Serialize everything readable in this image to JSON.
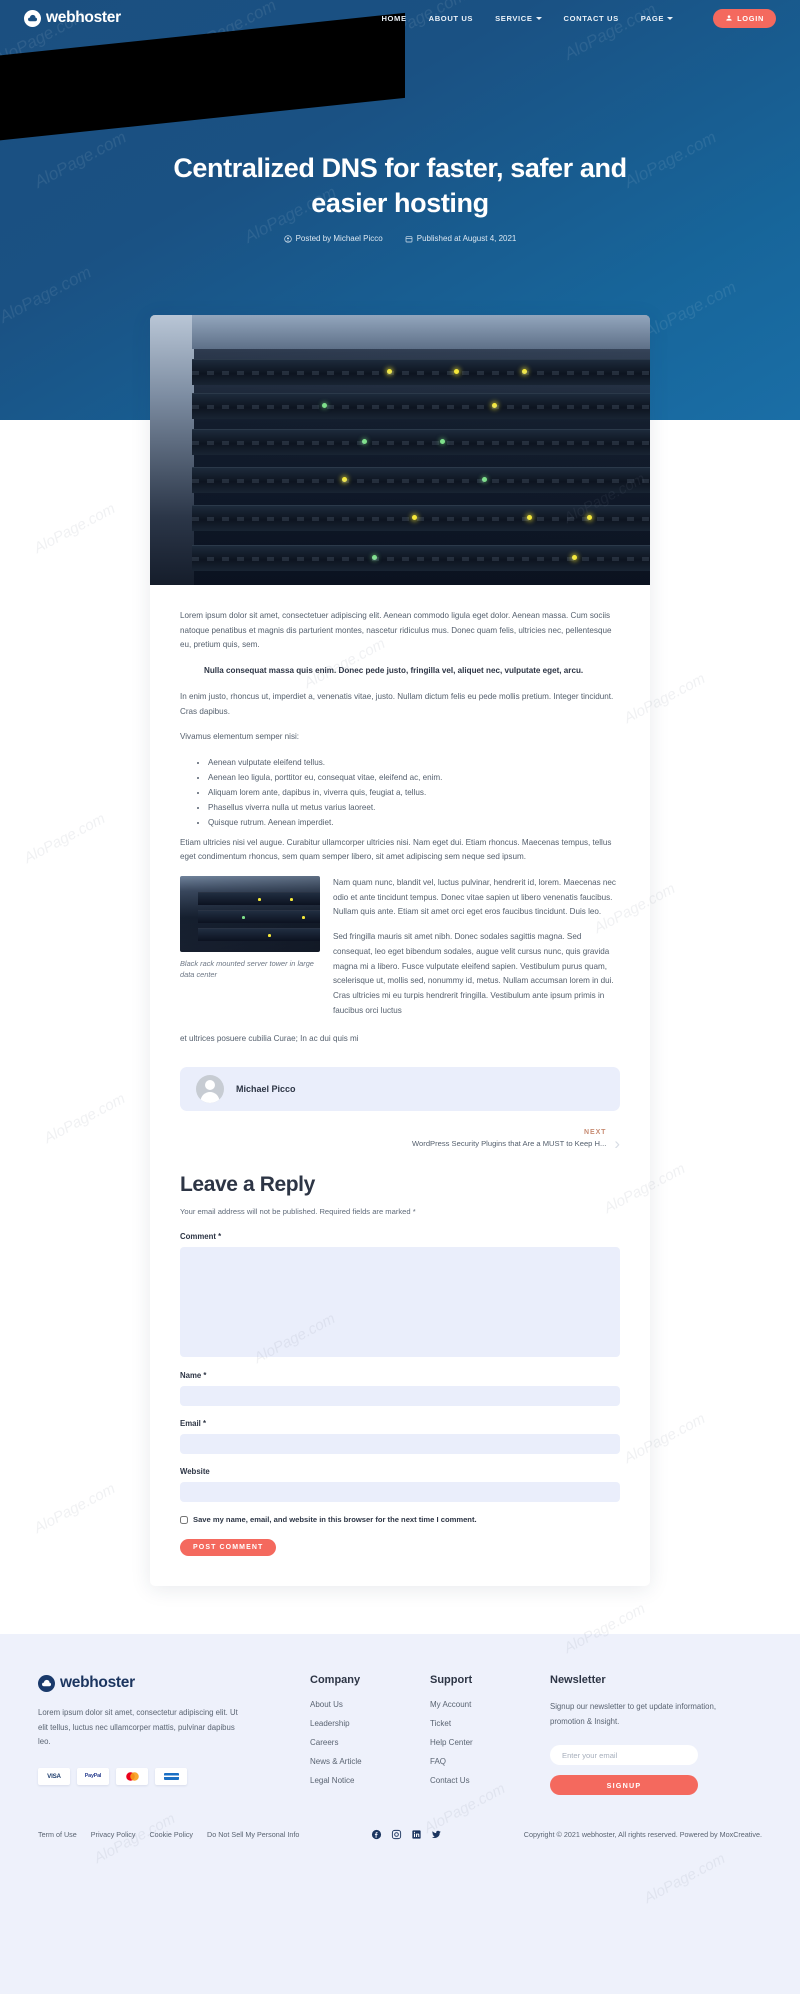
{
  "brand": {
    "name": "webhoster",
    "logo_icon": "cloud-icon"
  },
  "nav": {
    "items": [
      {
        "label": "HOME",
        "has_dropdown": false
      },
      {
        "label": "ABOUT US",
        "has_dropdown": false
      },
      {
        "label": "SERVICE",
        "has_dropdown": true
      },
      {
        "label": "CONTACT US",
        "has_dropdown": false
      },
      {
        "label": "PAGE",
        "has_dropdown": true
      }
    ],
    "login_label": "LOGIN",
    "login_icon": "user-icon",
    "login_color": "#f4695e"
  },
  "hero": {
    "title": "Centralized DNS for faster, safer and easier hosting",
    "author_meta": "Posted by Michael Picco",
    "author_icon": "user-circle-icon",
    "date_meta": "Published at August 4, 2021",
    "date_icon": "calendar-icon"
  },
  "article": {
    "featured_image_alt": "server-rack-photo",
    "paragraph_1": "Lorem ipsum dolor sit amet, consectetuer adipiscing elit. Aenean commodo ligula eget dolor. Aenean massa. Cum sociis natoque penatibus et magnis dis parturient montes, nascetur ridiculus mus. Donec quam felis, ultricies nec, pellentesque eu, pretium quis, sem.",
    "blockquote": "Nulla consequat massa quis enim. Donec pede justo, fringilla vel, aliquet nec, vulputate eget, arcu.",
    "paragraph_2": "In enim justo, rhoncus ut, imperdiet a, venenatis vitae, justo. Nullam dictum felis eu pede mollis pretium. Integer tincidunt. Cras dapibus.",
    "paragraph_3": "Vivamus elementum semper nisi:",
    "list_items": [
      "Aenean vulputate eleifend tellus.",
      "Aenean leo ligula, porttitor eu, consequat vitae, eleifend ac, enim.",
      "Aliquam lorem ante, dapibus in, viverra quis, feugiat a, tellus.",
      "Phasellus viverra nulla ut metus varius laoreet.",
      "Quisque rutrum. Aenean imperdiet."
    ],
    "paragraph_4": "Etiam ultricies nisi vel augue. Curabitur ullamcorper ultricies nisi. Nam eget dui. Etiam rhoncus. Maecenas tempus, tellus eget condimentum rhoncus, sem quam semper libero, sit amet adipiscing sem neque sed ipsum.",
    "figure_caption": "Black rack mounted server tower in large data center",
    "paragraph_5": "Nam quam nunc, blandit vel, luctus pulvinar, hendrerit id, lorem. Maecenas nec odio et ante tincidunt tempus. Donec vitae sapien ut libero venenatis faucibus. Nullam quis ante. Etiam sit amet orci eget eros faucibus tincidunt. Duis leo.",
    "paragraph_6": "Sed fringilla mauris sit amet nibh. Donec sodales sagittis magna. Sed consequat, leo eget bibendum sodales, augue velit cursus nunc, quis gravida magna mi a libero. Fusce vulputate eleifend sapien. Vestibulum purus quam, scelerisque ut, mollis sed, nonummy id, metus. Nullam accumsan lorem in dui. Cras ultricies mi eu turpis hendrerit fringilla. Vestibulum ante ipsum primis in faucibus orci luctus",
    "paragraph_7": "et ultrices posuere cubilia Curae; In ac dui quis mi"
  },
  "author_box": {
    "name": "Michael Picco",
    "avatar_icon": "avatar-icon"
  },
  "post_nav": {
    "next_label": "NEXT",
    "next_title": "WordPress Security Plugins that Are a MUST to Keep H...",
    "arrow_icon": "chevron-right-icon"
  },
  "comment_form": {
    "heading": "Leave a Reply",
    "note": "Your email address will not be published. Required fields are marked *",
    "comment_label": "Comment *",
    "comment_value": "",
    "comment_placeholder": "",
    "name_label": "Name *",
    "name_value": "",
    "email_label": "Email *",
    "email_value": "",
    "website_label": "Website",
    "website_value": "",
    "save_checkbox_label": "Save my name, email, and website in this browser for the next time I comment.",
    "submit_label": "POST COMMENT"
  },
  "footer": {
    "brand": "webhoster",
    "description": "Lorem ipsum dolor sit amet, consectetur adipiscing elit. Ut elit tellus, luctus nec ullamcorper mattis, pulvinar dapibus leo.",
    "payment_cards": [
      "VISA",
      "PayPal",
      "Mastercard",
      "Amex"
    ],
    "company": {
      "title": "Company",
      "links": [
        "About Us",
        "Leadership",
        "Careers",
        "News & Article",
        "Legal Notice"
      ]
    },
    "support": {
      "title": "Support",
      "links": [
        "My Account",
        "Ticket",
        "Help Center",
        "FAQ",
        "Contact Us"
      ]
    },
    "newsletter": {
      "title": "Newsletter",
      "description": "Signup our newsletter to get update information, promotion & Insight.",
      "email_placeholder": "Enter your email",
      "email_value": "",
      "signup_label": "SIGNUP"
    },
    "bottom_links": [
      "Term of Use",
      "Privacy Policy",
      "Cookie Policy",
      "Do Not Sell My Personal Info"
    ],
    "socials": [
      "facebook-icon",
      "instagram-icon",
      "linkedin-icon",
      "twitter-icon"
    ],
    "copyright": "Copyright © 2021 webhoster, All rights reserved. Powered by MoxCreative."
  },
  "watermark": {
    "text": "AloPage.com"
  }
}
